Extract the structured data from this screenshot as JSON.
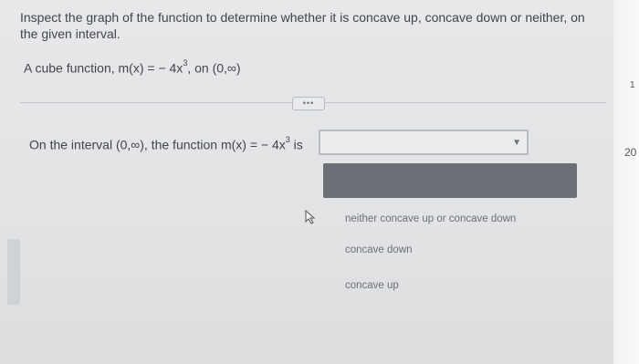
{
  "question": {
    "text": "Inspect the graph of the function to determine whether it is concave up, concave down or neither, on the given interval."
  },
  "function_line": {
    "prefix": "A cube function, m(x) = − 4x",
    "exponent": "3",
    "suffix": ", on (0,∞)"
  },
  "more_button": {
    "label": "•••"
  },
  "answer_line": {
    "prefix": "On the interval (0,∞), the function m(x) = − 4x",
    "exponent": "3",
    "suffix": " is"
  },
  "dropdown": {
    "selected": "",
    "options": [
      "neither concave up or concave down",
      "concave down",
      "concave up"
    ]
  },
  "side": {
    "number": "20",
    "mark": "1"
  }
}
